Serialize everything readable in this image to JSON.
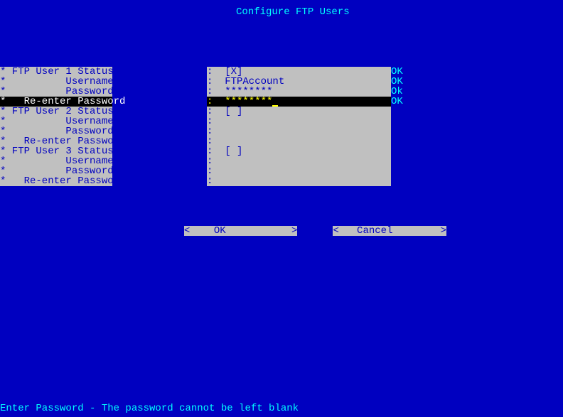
{
  "title": "Configure FTP Users",
  "rows": [
    {
      "label": "* FTP User 1 Status    ",
      "value": ":  [X]                               ",
      "ok": "OK",
      "hl": false
    },
    {
      "label": "*          Username    ",
      "value": ":  FTPAccount                        ",
      "ok": "OK",
      "hl": false
    },
    {
      "label": "*          Password    ",
      "value": ":  ********                          ",
      "ok": "Ok",
      "hl": false
    },
    {
      "label": "*   Re-enter Password  ",
      "value": ":  ********",
      "ok": "OK",
      "hl": true
    },
    {
      "label": "* FTP User 2 Status    ",
      "value": ":  [ ]                               ",
      "ok": "",
      "hl": false
    },
    {
      "label": "*          Username    ",
      "value": ":                                    ",
      "ok": "",
      "hl": false
    },
    {
      "label": "*          Password    ",
      "value": ":                                    ",
      "ok": "",
      "hl": false
    },
    {
      "label": "*   Re-enter Password  ",
      "value": ":                                    ",
      "ok": "",
      "hl": false
    },
    {
      "label": "* FTP User 3 Status    ",
      "value": ":  [ ]                               ",
      "ok": "",
      "hl": false
    },
    {
      "label": "*          Username    ",
      "value": ":                                    ",
      "ok": "",
      "hl": false
    },
    {
      "label": "*          Password    ",
      "value": ":                                    ",
      "ok": "",
      "hl": false
    },
    {
      "label": "*   Re-enter Password  ",
      "value": ":                                    ",
      "ok": "",
      "hl": false
    }
  ],
  "buttons": {
    "ok": "<    OK           >",
    "cancel": "<   Cancel        >"
  },
  "status": "Enter Password - The password cannot be left blank"
}
